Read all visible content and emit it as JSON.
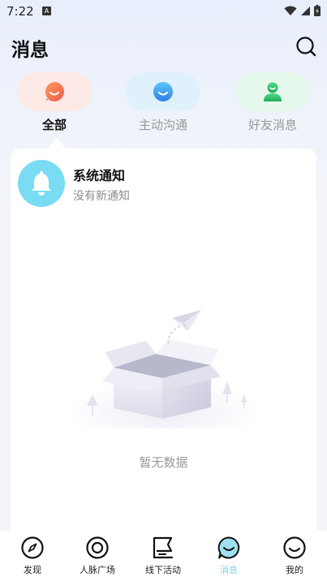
{
  "status_bar": {
    "time": "7:22",
    "notification_letter": "A"
  },
  "header": {
    "title": "消息"
  },
  "tabs": [
    {
      "label": "全部",
      "active": true,
      "color": "#f47c5c"
    },
    {
      "label": "主动沟通",
      "active": false,
      "color": "#3aa5f0"
    },
    {
      "label": "好友消息",
      "active": false,
      "color": "#34c46a"
    }
  ],
  "notice": {
    "title": "系统通知",
    "subtitle": "没有新通知",
    "icon": "bell-icon",
    "color": "#79dcf3"
  },
  "empty_state": {
    "text": "暂无数据"
  },
  "bottom_nav": [
    {
      "label": "发现",
      "icon": "compass-icon",
      "active": false
    },
    {
      "label": "人脉广场",
      "icon": "target-icon",
      "active": false
    },
    {
      "label": "线下活动",
      "icon": "flag-icon",
      "active": false
    },
    {
      "label": "消息",
      "icon": "chat-bubble-icon",
      "active": true
    },
    {
      "label": "我的",
      "icon": "smiley-icon",
      "active": false
    }
  ],
  "colors": {
    "accent": "#7fd3ea"
  }
}
